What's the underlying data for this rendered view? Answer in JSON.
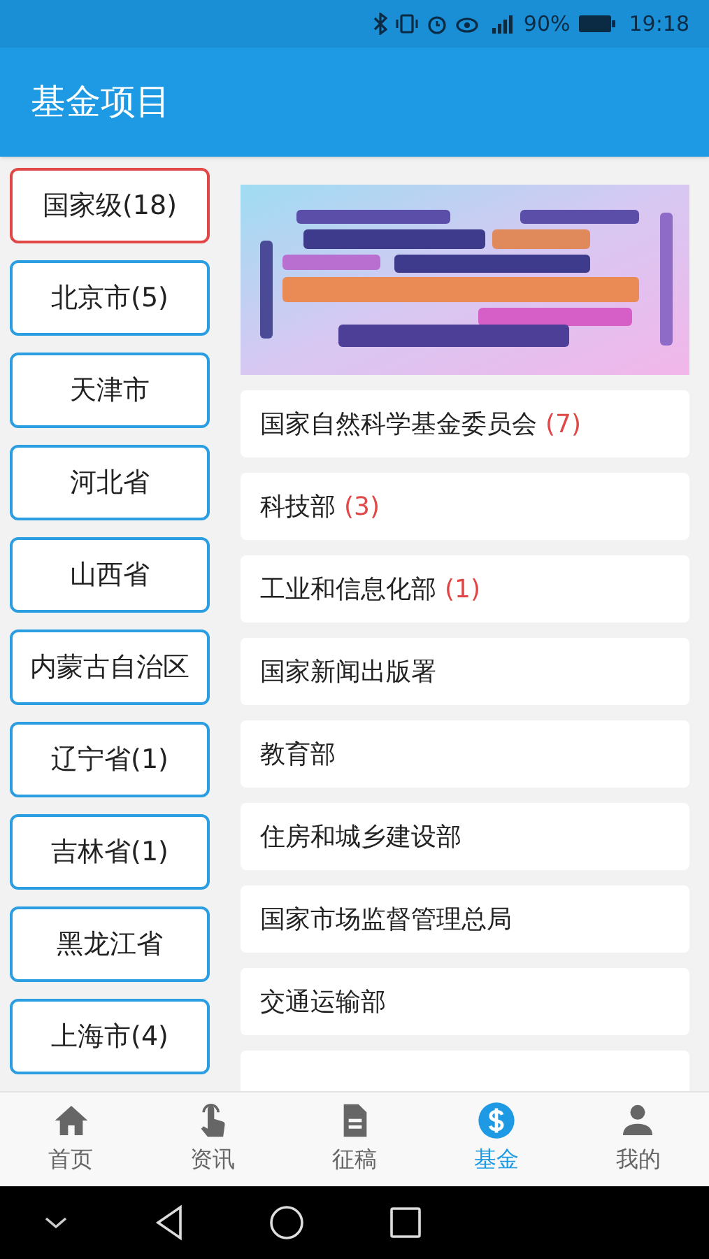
{
  "status_bar": {
    "battery": "90%",
    "time": "19:18"
  },
  "header": {
    "title": "基金项目"
  },
  "regions": [
    {
      "label": "国家级(18)",
      "selected": true
    },
    {
      "label": "北京市(5)",
      "selected": false
    },
    {
      "label": "天津市",
      "selected": false
    },
    {
      "label": "河北省",
      "selected": false
    },
    {
      "label": "山西省",
      "selected": false
    },
    {
      "label": "内蒙古自治区",
      "selected": false
    },
    {
      "label": "辽宁省(1)",
      "selected": false
    },
    {
      "label": "吉林省(1)",
      "selected": false
    },
    {
      "label": "黑龙江省",
      "selected": false
    },
    {
      "label": "上海市(4)",
      "selected": false
    }
  ],
  "agencies": [
    {
      "name": "国家自然科学基金委员会",
      "count": "(7)"
    },
    {
      "name": "科技部",
      "count": "(3)"
    },
    {
      "name": "工业和信息化部",
      "count": "(1)"
    },
    {
      "name": "国家新闻出版署"
    },
    {
      "name": "教育部"
    },
    {
      "name": "住房和城乡建设部"
    },
    {
      "name": "国家市场监督管理总局"
    },
    {
      "name": "交通运输部"
    }
  ],
  "tabs": [
    {
      "label": "首页",
      "selected": false
    },
    {
      "label": "资讯",
      "selected": false
    },
    {
      "label": "征稿",
      "selected": false
    },
    {
      "label": "基金",
      "selected": true
    },
    {
      "label": "我的",
      "selected": false
    }
  ]
}
